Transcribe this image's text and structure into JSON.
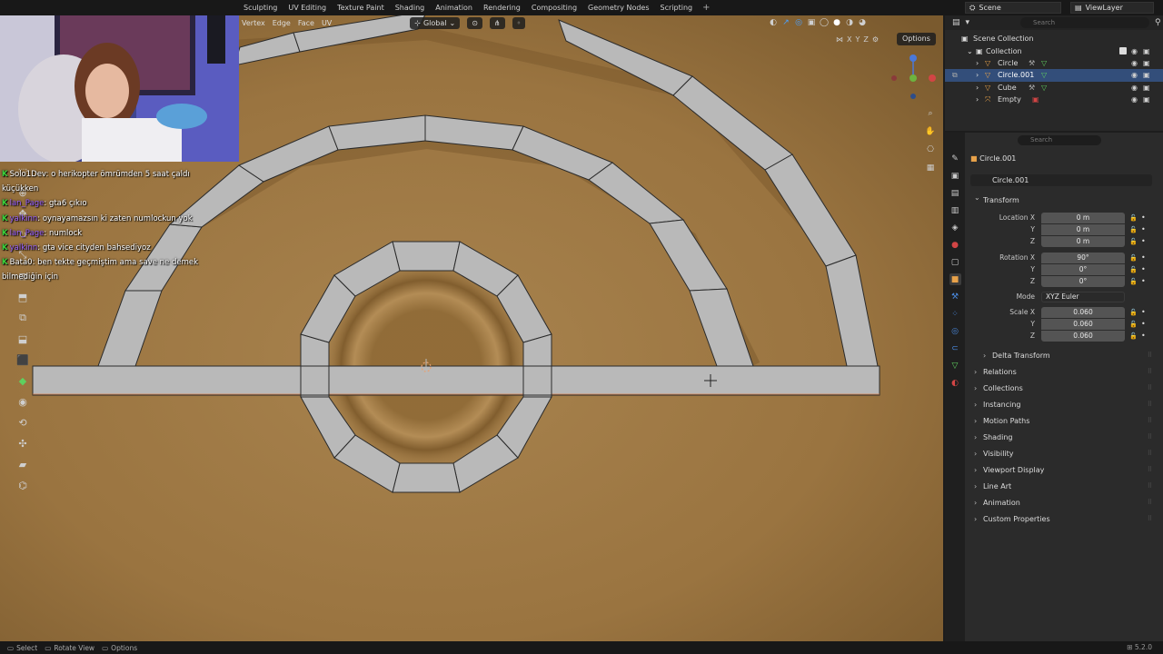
{
  "topbar": {
    "tabs": [
      "Sculpting",
      "UV Editing",
      "Texture Paint",
      "Shading",
      "Animation",
      "Rendering",
      "Compositing",
      "Geometry Nodes",
      "Scripting"
    ],
    "add_tab": "+",
    "scene": "Scene",
    "view_layer": "ViewLayer"
  },
  "viewport": {
    "menus": [
      "Vertex",
      "Edge",
      "Face",
      "UV"
    ],
    "orientation": "Global",
    "options": "Options",
    "axis_toggles": [
      "X",
      "Y",
      "Z"
    ]
  },
  "chat": [
    {
      "user": "Solo1Dev",
      "text": ": o herikopter ömrümden 5 saat çaldı küçükken",
      "user_color": "white"
    },
    {
      "user": "lan_Page",
      "text": ": gta6 çıkıo",
      "user_color": "purple"
    },
    {
      "user": "yalkinn",
      "text": ": oynayamazsın ki zaten numlockun yok",
      "user_color": "purple"
    },
    {
      "user": "lan_Page",
      "text": ": numlock",
      "user_color": "purple"
    },
    {
      "user": "yalkinn",
      "text": ": gta vice cityden bahsediyoz",
      "user_color": "purple"
    },
    {
      "user": "Bata0",
      "text": ": ben tekte geçmiştim ama save ne demek bilmediğin için",
      "user_color": "white"
    }
  ],
  "outliner": {
    "search_placeholder": "Search",
    "scene_collection": "Scene Collection",
    "collection": "Collection",
    "objects": [
      {
        "name": "Circle",
        "selected": false
      },
      {
        "name": "Circle.001",
        "selected": true
      },
      {
        "name": "Cube",
        "selected": false
      },
      {
        "name": "Empty",
        "selected": false
      }
    ]
  },
  "properties": {
    "search_placeholder": "Search",
    "object_title": "Circle.001",
    "object_name": "Circle.001",
    "transform_label": "Transform",
    "location": {
      "label": "Location X",
      "x": "0 m",
      "y": "0 m",
      "z": "0 m"
    },
    "rotation": {
      "label": "Rotation X",
      "x": "90°",
      "y": "0°",
      "z": "0°"
    },
    "mode": {
      "label": "Mode",
      "value": "XYZ Euler"
    },
    "scale": {
      "label": "Scale X",
      "x": "0.060",
      "y": "0.060",
      "z": "0.060"
    },
    "axis_y": "Y",
    "axis_z": "Z",
    "delta_transform": "Delta Transform",
    "panels": [
      "Relations",
      "Collections",
      "Instancing",
      "Motion Paths",
      "Shading",
      "Visibility",
      "Viewport Display",
      "Line Art",
      "Animation",
      "Custom Properties"
    ]
  },
  "statusbar": {
    "select": "Select",
    "rotate_view": "Rotate View",
    "options": "Options",
    "version": "5.2.0"
  },
  "colors": {
    "selection_blue": "#334e7a",
    "mesh_face": "#b9b9b9",
    "floor": "#9a7440",
    "active_tool": "#5fd05f"
  }
}
